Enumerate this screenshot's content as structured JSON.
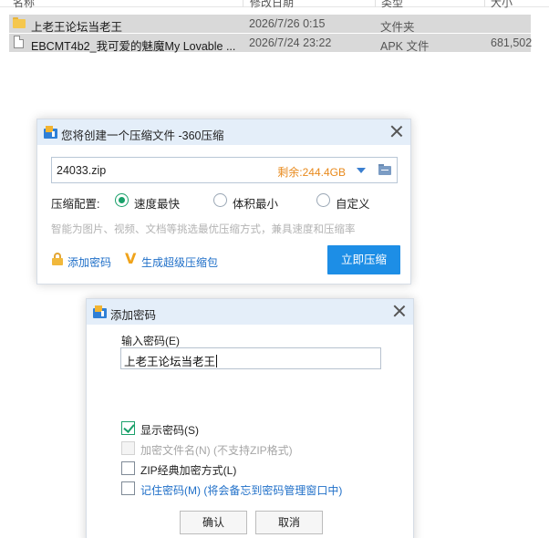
{
  "explorer": {
    "headers": [
      "名称",
      "修改日期",
      "类型",
      "大小"
    ],
    "files": [
      {
        "name": "上老王论坛当老王",
        "date": "2026/7/26 0:15",
        "type": "文件夹",
        "size": "",
        "icon": "folder-icon"
      },
      {
        "name": "EBCMT4b2_我可爱的魅魔My Lovable ...",
        "date": "2026/7/24 23:22",
        "type": "APK 文件",
        "size": "681,502",
        "icon": "file-icon"
      }
    ]
  },
  "compress_dialog": {
    "title": "您将创建一个压缩文件 -360压缩",
    "path": "24033.zip",
    "free_space": "剩余:244.4GB",
    "config_label": "压缩配置:",
    "options": [
      "速度最快",
      "体积最小",
      "自定义"
    ],
    "selected_option": "速度最快",
    "hint": "智能为图片、视频、文档等挑选最优压缩方式，兼具速度和压缩率",
    "add_password": "添加密码",
    "super_package": "生成超级压缩包",
    "compress_button": "立即压缩",
    "accent_color": "#1d8ee6"
  },
  "password_dialog": {
    "title": "添加密码",
    "input_label": "输入密码(E)",
    "password": "上老王论坛当老王",
    "checkboxes": [
      {
        "label": "显示密码(S)",
        "checked": true,
        "disabled": false
      },
      {
        "label": "加密文件名(N) (不支持ZIP格式)",
        "checked": false,
        "disabled": true
      },
      {
        "label": "ZIP经典加密方式(L)",
        "checked": false,
        "disabled": false
      },
      {
        "label": "记住密码(M) (将会备忘到密码管理窗口中)",
        "checked": false,
        "disabled": false
      }
    ],
    "ok_button": "确认",
    "cancel_button": "取消"
  }
}
